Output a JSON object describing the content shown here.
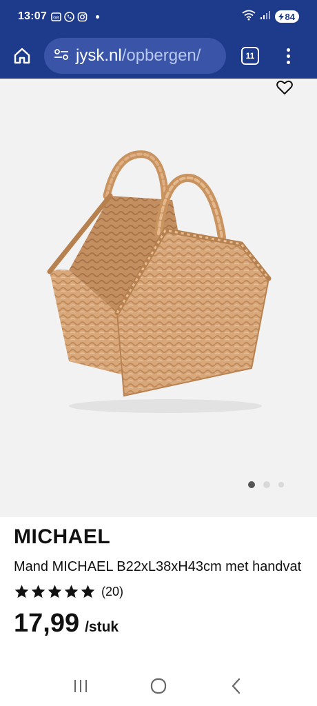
{
  "status_bar": {
    "time": "13:07",
    "battery": "84",
    "icons": [
      "gallery-icon",
      "phone-icon",
      "instagram-icon",
      "wifi-icon",
      "signal-icon"
    ]
  },
  "browser": {
    "url_domain": "jysk.nl",
    "url_path": "/opbergen/",
    "tab_count": "11"
  },
  "carousel": {
    "total": 3,
    "active_index": 0
  },
  "product": {
    "title": "MICHAEL",
    "description": "Mand MICHAEL B22xL38xH43cm met handvat",
    "rating_stars": 5,
    "rating_count": "(20)",
    "price": "17,99",
    "price_unit": "/stuk"
  },
  "colors": {
    "brand_blue": "#1e3a8a",
    "url_pill": "#3a55a8",
    "image_bg": "#f2f2f2"
  }
}
